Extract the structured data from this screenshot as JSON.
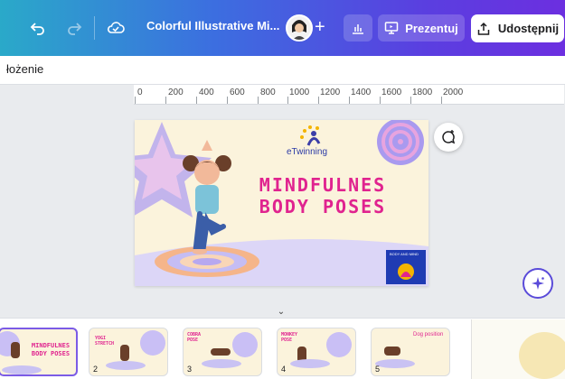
{
  "toolbar": {
    "doc_title": "Colorful Illustrative Mi...",
    "present_label": "Prezentuj",
    "share_label": "Udostępnij"
  },
  "subbar": {
    "label": "łożenie"
  },
  "ruler": {
    "ticks": [
      "0",
      "200",
      "400",
      "600",
      "800",
      "1000",
      "1200",
      "1400",
      "1600",
      "1800",
      "2000"
    ]
  },
  "slide": {
    "logo_text": "eTwinning",
    "title_line1": "MINDFULNES",
    "title_line2": "BODY POSES",
    "book_text": "BODY AND MIND"
  },
  "filmstrip": {
    "thumbs": [
      {
        "num": "",
        "title": "MINDFULNES BODY POSES"
      },
      {
        "num": "2",
        "title": "YOGI STRETCH"
      },
      {
        "num": "3",
        "title": "COBRA POSE"
      },
      {
        "num": "4",
        "title": "MONKEY POSE"
      },
      {
        "num": "5",
        "title": "Dog position"
      }
    ]
  },
  "colors": {
    "accent": "#7b5be6",
    "title_pink": "#e0238f",
    "slide_bg": "#fbf3dc"
  }
}
